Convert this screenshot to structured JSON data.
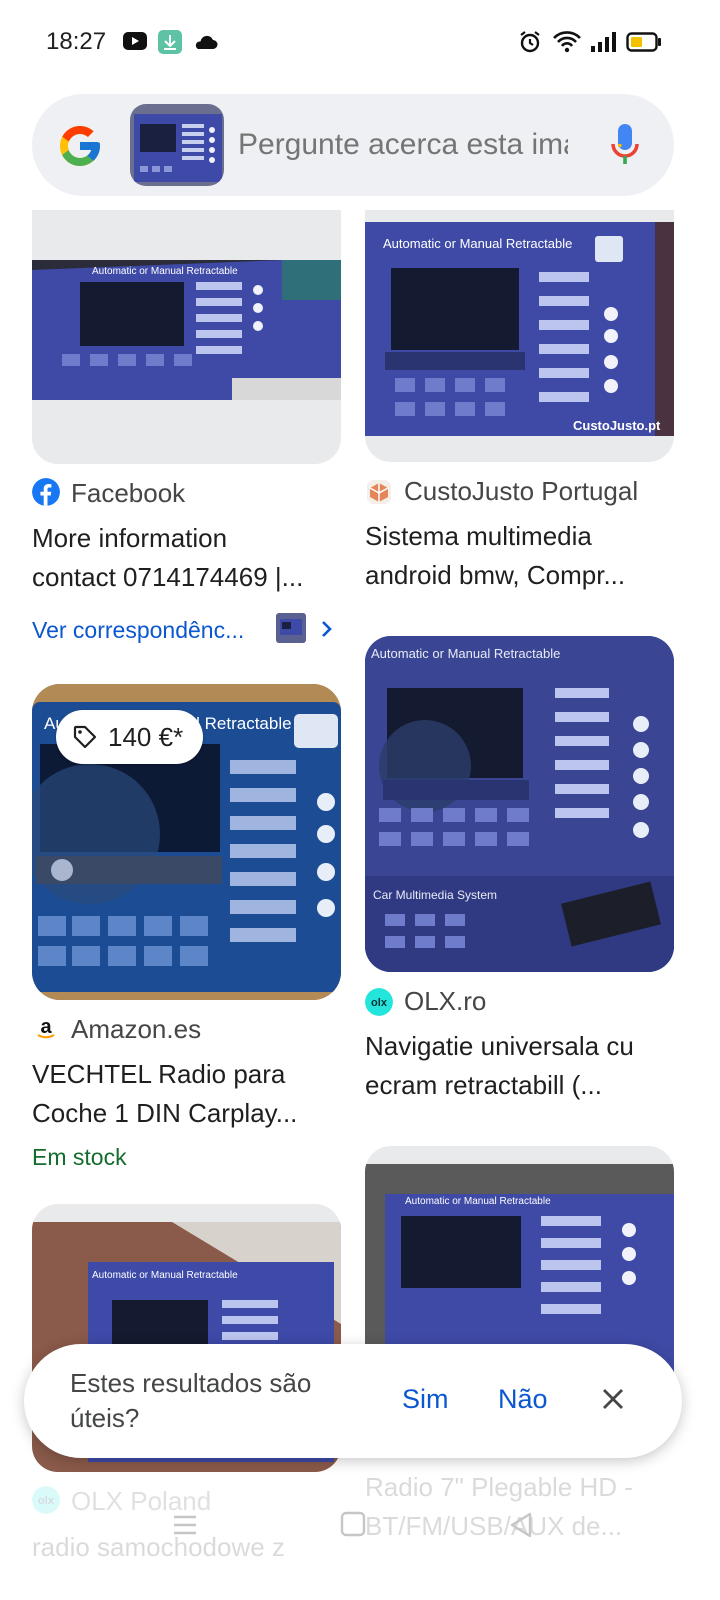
{
  "status": {
    "time": "18:27"
  },
  "search": {
    "placeholder": "Pergunte acerca esta imagem"
  },
  "results": [
    {
      "source": "Facebook",
      "title_l1": "More information",
      "title_l2": "contact 0714174469 |...",
      "link": "Ver correspondênc...",
      "box_text": "Automatic or Manual Retractable"
    },
    {
      "source": "CustoJusto Portugal",
      "title_l1": "Sistema multimedia",
      "title_l2": "android bmw, Compr...",
      "box_text": "Automatic or Manual Retractable",
      "watermark": "CustoJusto.pt"
    },
    {
      "source": "Amazon.es",
      "price": "140 €*",
      "title_l1": "VECHTEL Radio para",
      "title_l2": "Coche 1 DIN Carplay...",
      "stock": "Em stock",
      "box_text": "Automatic or Manual Retractable"
    },
    {
      "source": "OLX.ro",
      "title_l1": "Navigatie universala cu",
      "title_l2": "ecram retractabill (...",
      "box_text": "Automatic or Manual Retractable",
      "box_text2": "Car Multimedia System"
    },
    {
      "source": "OLX Poland",
      "title_l1": "radio samochodowe z",
      "box_text": "Automatic or Manual Retractable"
    },
    {
      "title_l1": "Radio 7\" Plegable HD -",
      "title_l2": "BT/FM/USB/AUX de...",
      "box_text": "Automatic or Manual Retractable"
    }
  ],
  "feedback": {
    "question": "Estes resultados são úteis?",
    "yes": "Sim",
    "no": "Não"
  },
  "colors": {
    "accent": "#0b57d0",
    "stock": "#146c2e",
    "box_blue": "#3d4aa8"
  }
}
